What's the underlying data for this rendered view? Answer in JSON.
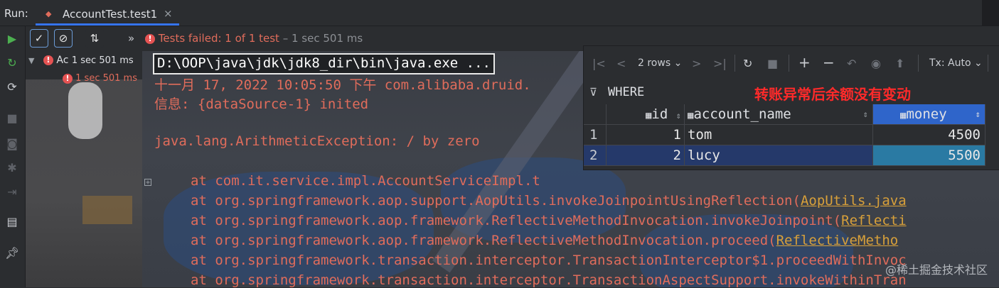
{
  "top_bar": {
    "run_label": "Run:",
    "tab_title": "AccountTest.test1",
    "close": "×"
  },
  "tests_toolbar": {
    "status_failed": "Tests failed: 1 of 1 test",
    "status_time": "– 1 sec 501 ms",
    "more": "»"
  },
  "test_tree": {
    "row1_name": "Ac",
    "row1_time": "1 sec 501 ms",
    "row2_time": "1 sec 501 ms"
  },
  "console": {
    "command": "D:\\OOP\\java\\jdk\\jdk8_dir\\bin\\java.exe ...",
    "line_date": "十一月 17, 2022 10:05:50 下午 com.alibaba.druid.",
    "line_info": "信息: {dataSource-1} inited",
    "exception": "java.lang.ArithmeticException: / by zero",
    "stack": [
      {
        "prefix": "at com.it.service.impl.AccountServiceImpl.t",
        "link": ""
      },
      {
        "prefix": "at org.springframework.aop.support.AopUtils.invokeJoinpointUsingReflection(",
        "link": "AopUtils.java"
      },
      {
        "prefix": "at org.springframework.aop.framework.ReflectiveMethodInvocation.invokeJoinpoint(",
        "link": "Reflecti"
      },
      {
        "prefix": "at org.springframework.aop.framework.ReflectiveMethodInvocation.proceed(",
        "link": "ReflectiveMetho"
      },
      {
        "prefix": "at org.springframework.transaction.interceptor.TransactionInterceptor$1.proceedWithInvoc",
        "link": ""
      },
      {
        "prefix": "at org.springframework.transaction.interceptor.TransactionAspectSupport.invokeWithinTran",
        "link": ""
      }
    ]
  },
  "db_panel": {
    "rows_label": "2 rows",
    "tx_label": "Tx: Auto",
    "where_label": "WHERE",
    "annotation": "转账异常后余额没有变动",
    "columns": [
      "id",
      "account_name",
      "money"
    ],
    "rows": [
      {
        "num": "1",
        "id": "1",
        "account_name": "tom",
        "money": "4500"
      },
      {
        "num": "2",
        "id": "2",
        "account_name": "lucy",
        "money": "5500"
      }
    ]
  },
  "watermark": "@稀土掘金技术社区",
  "colors": {
    "error": "#e06c5b",
    "accent": "#3574f0",
    "selected_row": "#25396a",
    "money_header": "#2f65ca"
  }
}
